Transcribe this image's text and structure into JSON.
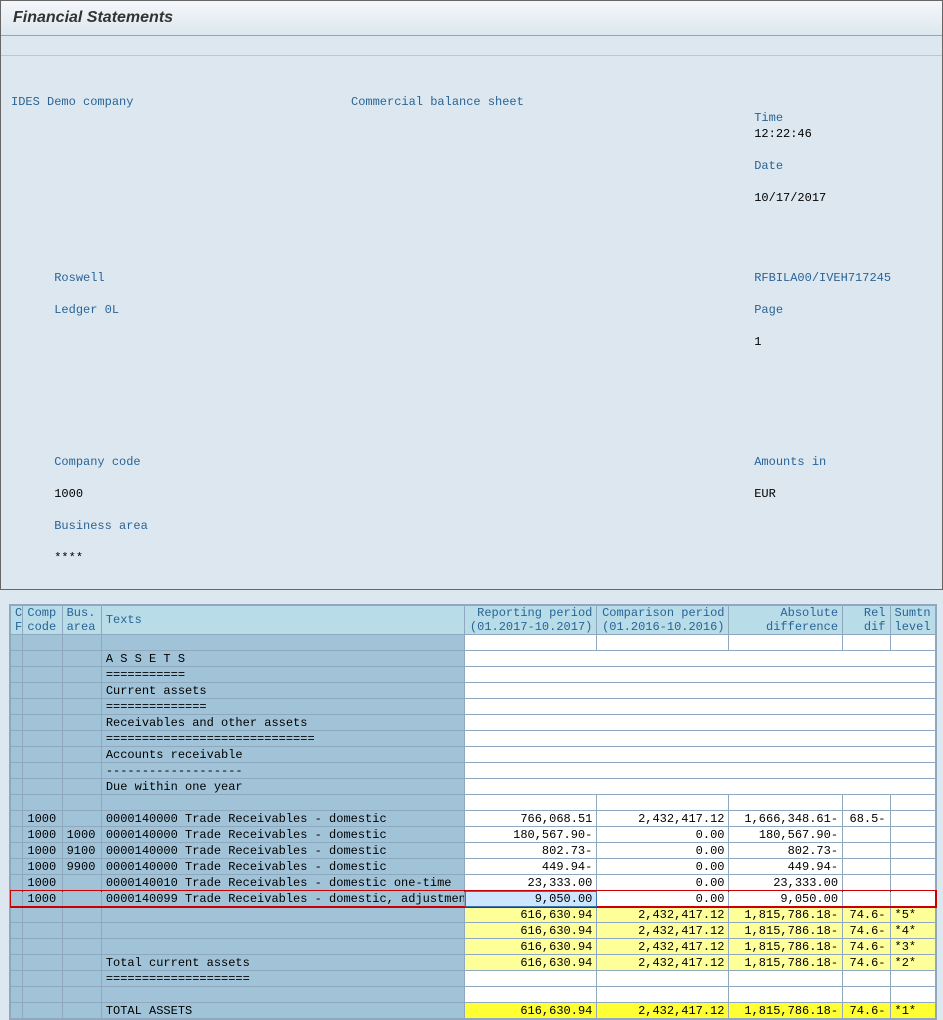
{
  "title": "Financial Statements",
  "meta": {
    "company": "IDES Demo company",
    "location": "Roswell",
    "ledger_label": "Ledger 0L",
    "sheetType": "Commercial balance sheet",
    "time_label": "Time",
    "time": "12:22:46",
    "date_label": "Date",
    "date": "10/17/2017",
    "program": "RFBILA00/IVEH717245",
    "page_label": "Page",
    "page": "1",
    "companyCodeLabel": "Company code",
    "companyCode": "1000",
    "businessAreaLabel": "Business area",
    "businessAreaMask": "****",
    "amountsInLabel": "Amounts in",
    "currency": "EUR"
  },
  "headers": {
    "cf1": "C",
    "cf2": "F",
    "comp1": "Comp",
    "comp2": "code",
    "bus1": "Bus.",
    "bus2": "area",
    "texts": "Texts",
    "rep1": "Reporting period",
    "rep2": "(01.2017-10.2017)",
    "cmp1": "Comparison period",
    "cmp2": "(01.2016-10.2016)",
    "abs1": "Absolute",
    "abs2": "difference",
    "rel1": "Rel",
    "rel2": "dif",
    "sum1": "Sumtn",
    "sum2": "level"
  },
  "section": {
    "assets": "A S S E T S",
    "sep1": "===========",
    "curr": "Current assets",
    "sep2": "==============",
    "receiv": "Receivables and other assets",
    "sep3": "=============================",
    "acct": "Accounts receivable",
    "sep4": "-------------------",
    "due": "Due within one year",
    "totalCurr": "Total current assets",
    "sep5": "====================",
    "totalAssets": "TOTAL ASSETS"
  },
  "rows": [
    {
      "comp": "1000",
      "bus": "",
      "text": "0000140000 Trade Receivables - domestic",
      "rep": "766,068.51",
      "cmp": "2,432,417.12",
      "abs": "1,666,348.61-",
      "rel": "68.5-",
      "sum": ""
    },
    {
      "comp": "1000",
      "bus": "1000",
      "text": "0000140000 Trade Receivables - domestic",
      "rep": "180,567.90-",
      "cmp": "0.00",
      "abs": "180,567.90-",
      "rel": "",
      "sum": ""
    },
    {
      "comp": "1000",
      "bus": "9100",
      "text": "0000140000 Trade Receivables - domestic",
      "rep": "802.73-",
      "cmp": "0.00",
      "abs": "802.73-",
      "rel": "",
      "sum": ""
    },
    {
      "comp": "1000",
      "bus": "9900",
      "text": "0000140000 Trade Receivables - domestic",
      "rep": "449.94-",
      "cmp": "0.00",
      "abs": "449.94-",
      "rel": "",
      "sum": ""
    },
    {
      "comp": "1000",
      "bus": "",
      "text": "0000140010 Trade Receivables - domestic one-time",
      "rep": "23,333.00",
      "cmp": "0.00",
      "abs": "23,333.00",
      "rel": "",
      "sum": ""
    },
    {
      "comp": "1000",
      "bus": "",
      "text": "0000140099 Trade Receivables - domestic, adjustmen",
      "rep": "9,050.00",
      "cmp": "0.00",
      "abs": "9,050.00",
      "rel": "",
      "sum": "",
      "hl": true,
      "sel": true
    }
  ],
  "subtotals": [
    {
      "rep": "616,630.94",
      "cmp": "2,432,417.12",
      "abs": "1,815,786.18-",
      "rel": "74.6-",
      "sum": "*5*"
    },
    {
      "rep": "616,630.94",
      "cmp": "2,432,417.12",
      "abs": "1,815,786.18-",
      "rel": "74.6-",
      "sum": "*4*"
    },
    {
      "rep": "616,630.94",
      "cmp": "2,432,417.12",
      "abs": "1,815,786.18-",
      "rel": "74.6-",
      "sum": "*3*"
    }
  ],
  "totalCurrRow": {
    "rep": "616,630.94",
    "cmp": "2,432,417.12",
    "abs": "1,815,786.18-",
    "rel": "74.6-",
    "sum": "*2*"
  },
  "totalAssetsRow": {
    "rep": "616,630.94",
    "cmp": "2,432,417.12",
    "abs": "1,815,786.18-",
    "rel": "74.6-",
    "sum": "*1*"
  }
}
